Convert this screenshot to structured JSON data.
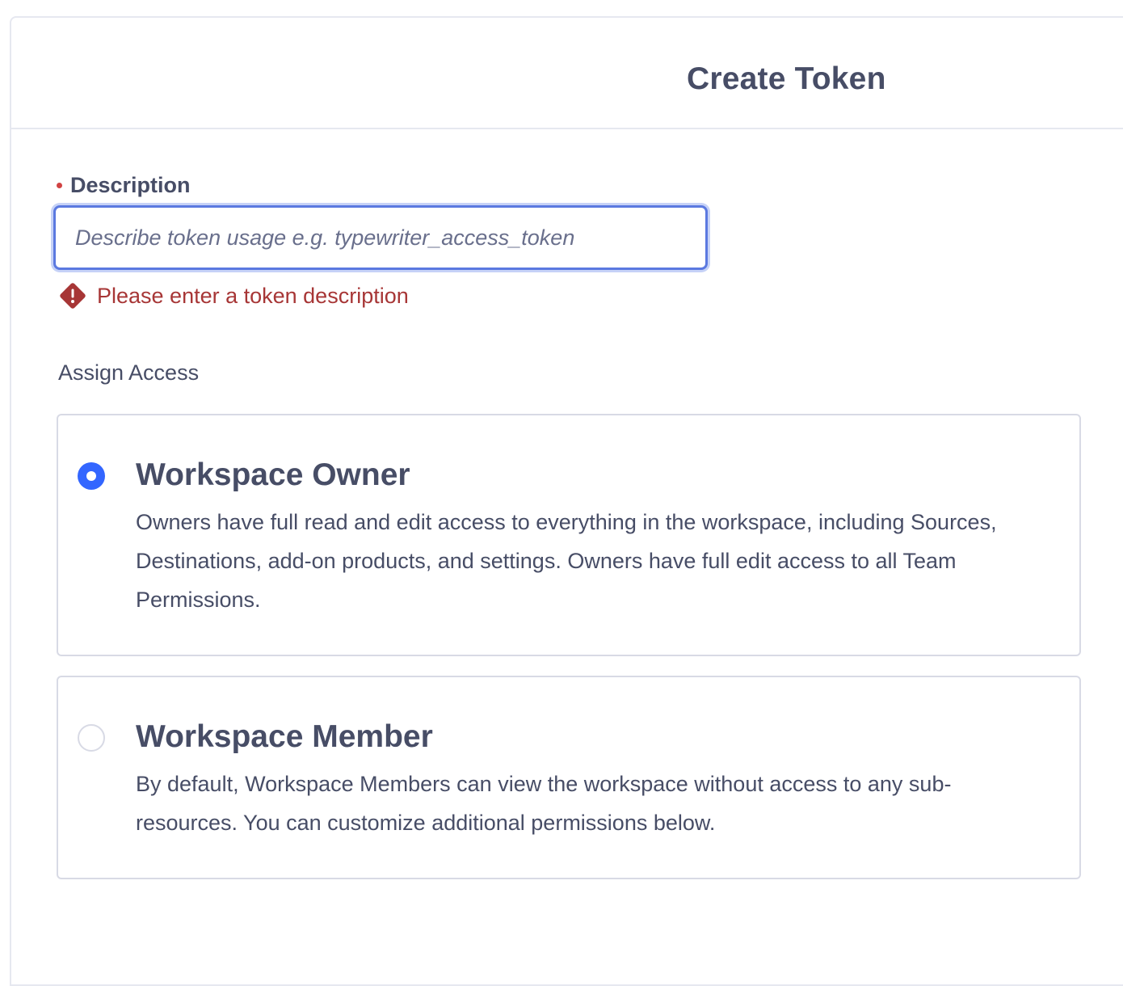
{
  "modal": {
    "title": "Create Token"
  },
  "form": {
    "description": {
      "label": "Description",
      "value": "",
      "placeholder": "Describe token usage e.g. typewriter_access_token",
      "error": "Please enter a token description"
    },
    "access": {
      "label": "Assign Access",
      "options": [
        {
          "title": "Workspace Owner",
          "description": "Owners have full read and edit access to everything in the workspace, including Sources, Destinations, add-on products, and settings. Owners have full edit access to all Team Permissions.",
          "selected": true
        },
        {
          "title": "Workspace Member",
          "description": "By default, Workspace Members can view the workspace without access to any sub-resources. You can customize additional permissions below.",
          "selected": false
        }
      ]
    }
  },
  "colors": {
    "accent": "#3366ff",
    "error": "#a73636",
    "text": "#474d66",
    "border": "#d8dae5"
  },
  "icons": {
    "error": "error-diamond-icon"
  }
}
